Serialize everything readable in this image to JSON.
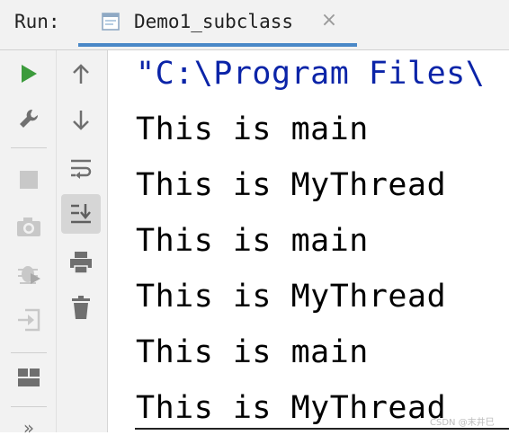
{
  "header": {
    "run_label": "Run:",
    "tab": {
      "label": "Demo1_subclass",
      "close": "×"
    }
  },
  "toolbar_left": [
    {
      "name": "rerun-icon",
      "color": "#3c9b3c"
    },
    {
      "name": "wrench-icon"
    },
    {
      "name": "stop-icon"
    },
    {
      "name": "camera-icon"
    },
    {
      "name": "debug-icon"
    },
    {
      "name": "login-icon"
    },
    {
      "name": "layout-icon"
    },
    {
      "name": "more-icon",
      "label": "»"
    }
  ],
  "toolbar_right": [
    {
      "name": "arrow-up-icon"
    },
    {
      "name": "arrow-down-icon"
    },
    {
      "name": "soft-wrap-icon"
    },
    {
      "name": "scroll-to-end-icon",
      "active": true
    },
    {
      "name": "print-icon"
    },
    {
      "name": "trash-icon"
    }
  ],
  "console": {
    "lines": [
      "\"C:\\Program Files\\",
      "This is main",
      "This is MyThread",
      "This is main",
      "This is MyThread",
      "This is main",
      "This is MyThread"
    ],
    "command_color": "#0b24a8"
  },
  "watermark": "CSDN @末井巳"
}
